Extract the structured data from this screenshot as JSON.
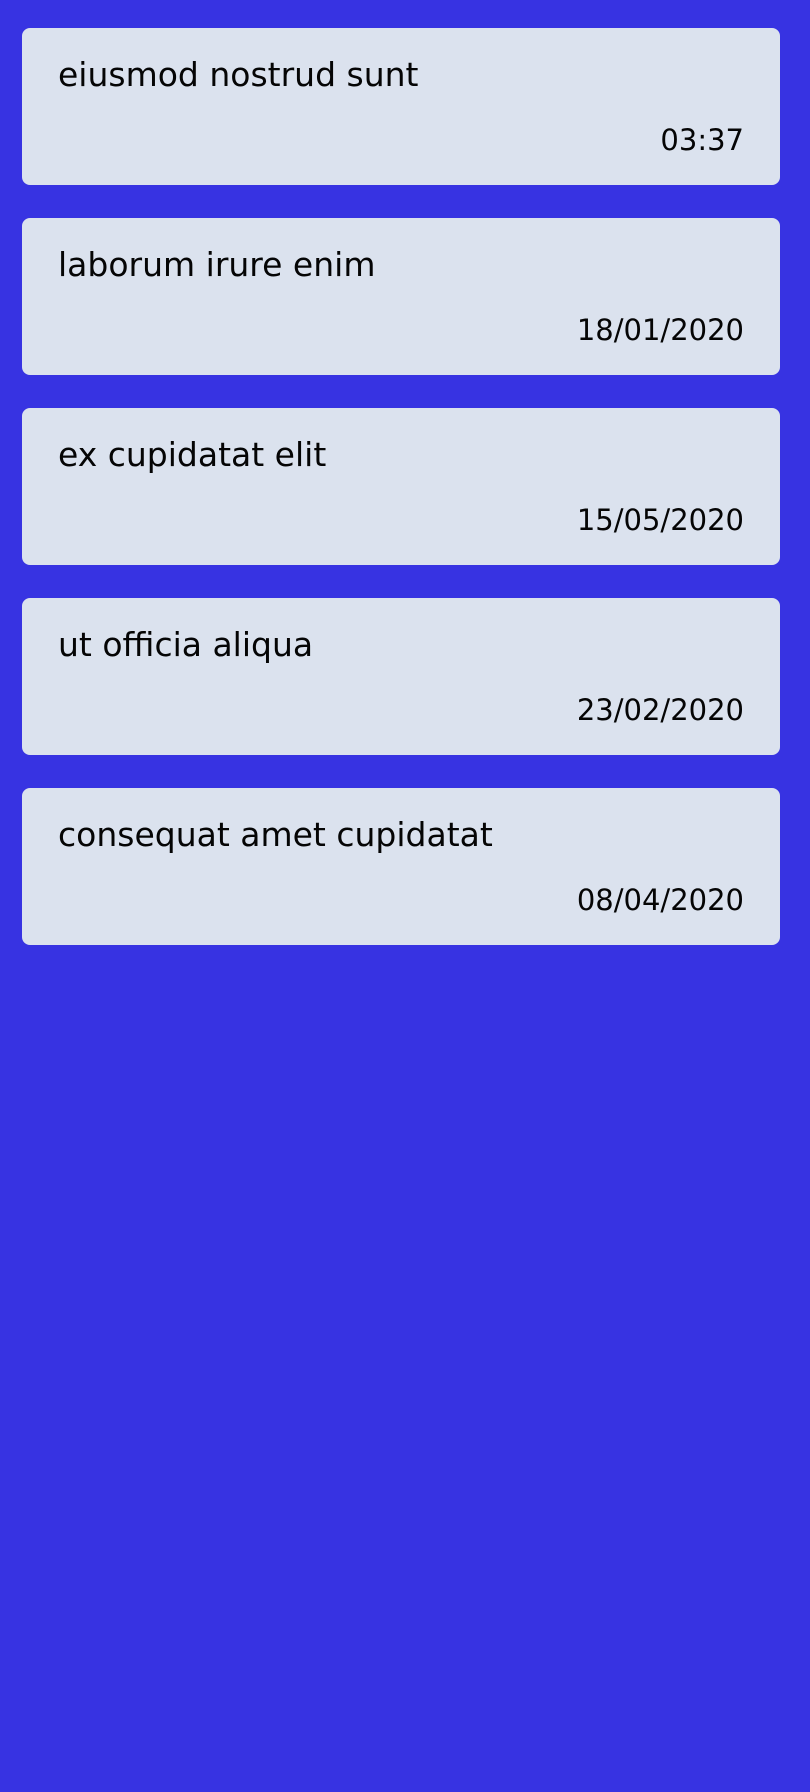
{
  "colors": {
    "background": "#3733E2",
    "card": "#DBE2EE",
    "text": "#050505"
  },
  "items": [
    {
      "title": "eiusmod nostrud sunt",
      "date": "03:37"
    },
    {
      "title": "laborum irure enim",
      "date": "18/01/2020"
    },
    {
      "title": "ex cupidatat elit",
      "date": "15/05/2020"
    },
    {
      "title": "ut officia aliqua",
      "date": "23/02/2020"
    },
    {
      "title": "consequat amet cupidatat",
      "date": "08/04/2020"
    }
  ]
}
